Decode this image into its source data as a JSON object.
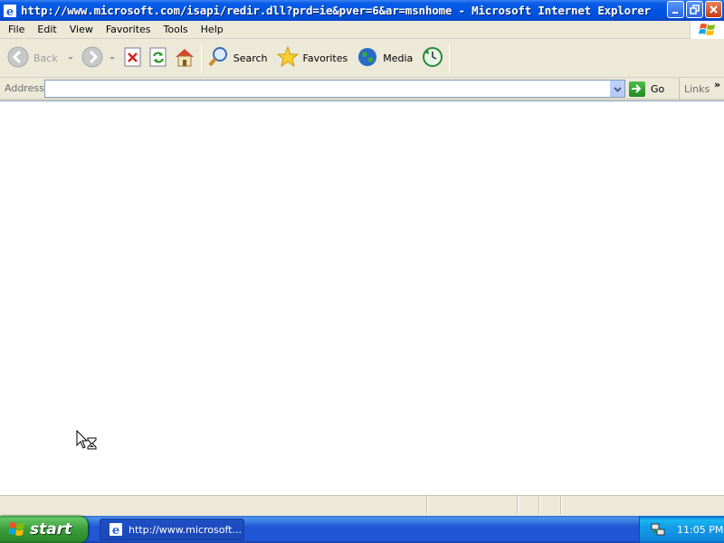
{
  "window": {
    "title": "http://www.microsoft.com/isapi/redir.dll?prd=ie&pver=6&ar=msnhome - Microsoft Internet Explorer",
    "icon": "ie-icon"
  },
  "window_controls": {
    "minimize_icon": "minimize-icon",
    "restore_icon": "restore-icon",
    "close_icon": "close-icon"
  },
  "menubar": {
    "items": [
      {
        "label": "File"
      },
      {
        "label": "Edit"
      },
      {
        "label": "View"
      },
      {
        "label": "Favorites"
      },
      {
        "label": "Tools"
      },
      {
        "label": "Help"
      }
    ]
  },
  "toolbar": {
    "back_label": "Back",
    "search_label": "Search",
    "favorites_label": "Favorites",
    "media_label": "Media"
  },
  "addressbar": {
    "label": "Address",
    "value": "",
    "go_label": "Go",
    "links_label": "Links",
    "links_chevron": "»"
  },
  "taskbar": {
    "start_label": "start",
    "task_label": "http://www.microsoft...",
    "clock": "11:05 PM"
  },
  "colors": {
    "titlebar": "#0054e3",
    "taskbar": "#2157d7",
    "start": "#3a9d3a",
    "tray": "#139ee9",
    "chrome": "#ece9d8"
  }
}
